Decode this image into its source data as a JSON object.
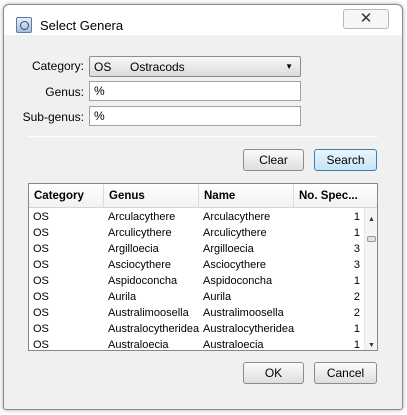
{
  "window": {
    "title": "Select Genera",
    "close_glyph": "✕"
  },
  "form": {
    "category_label": "Category:",
    "category_code": "OS",
    "category_name": "Ostracods",
    "genus_label": "Genus:",
    "genus_value": "%",
    "subgenus_label": "Sub-genus:",
    "subgenus_value": "%"
  },
  "buttons": {
    "clear": "Clear",
    "search": "Search",
    "ok": "OK",
    "cancel": "Cancel"
  },
  "table": {
    "headers": [
      "Category",
      "Genus",
      "Name",
      "No. Spec..."
    ],
    "rows": [
      [
        "OS",
        "Arculacythere",
        "Arculacythere",
        "1"
      ],
      [
        "OS",
        "Arculicythere",
        "Arculicythere",
        "1"
      ],
      [
        "OS",
        "Argilloecia",
        "Argilloecia",
        "3"
      ],
      [
        "OS",
        "Asciocythere",
        "Asciocythere",
        "3"
      ],
      [
        "OS",
        "Aspidoconcha",
        "Aspidoconcha",
        "1"
      ],
      [
        "OS",
        "Aurila",
        "Aurila",
        "2"
      ],
      [
        "OS",
        "Australimoosella",
        "Australimoosella",
        "2"
      ],
      [
        "OS",
        "Australocytheridea",
        "Australocytheridea",
        "1"
      ],
      [
        "OS",
        "Australoecia",
        "Australoecia",
        "1"
      ]
    ]
  }
}
